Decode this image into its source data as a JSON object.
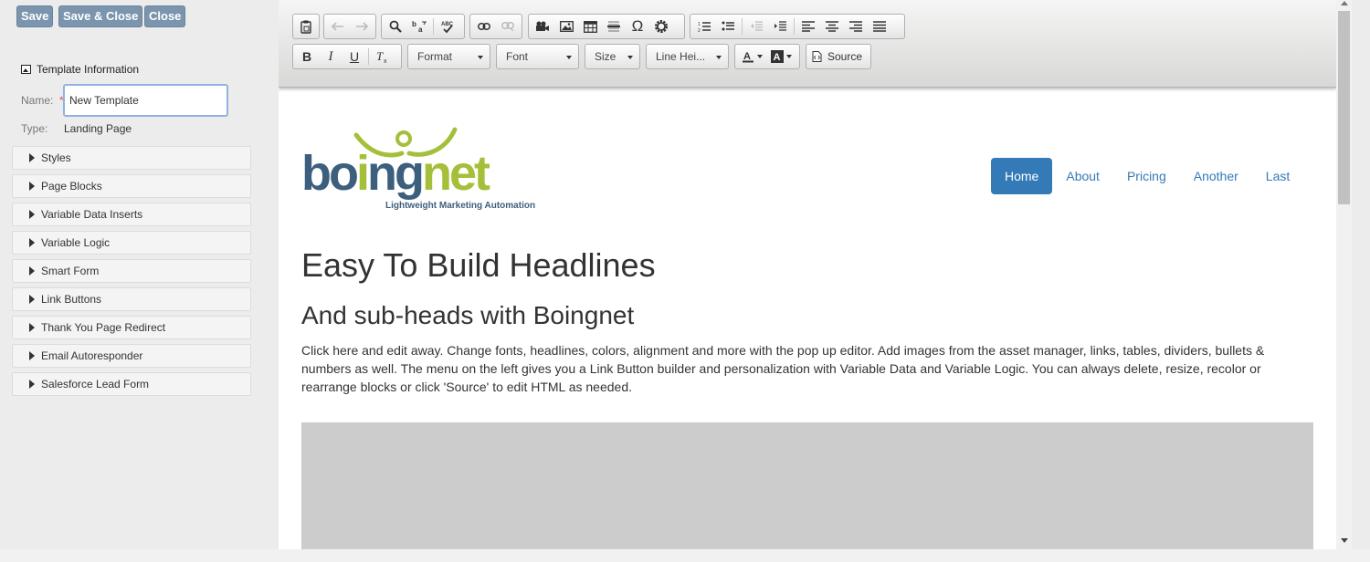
{
  "actions": {
    "save": "Save",
    "save_close": "Save & Close",
    "close": "Close"
  },
  "template_info": {
    "title": "Template Information",
    "name_label": "Name:",
    "required_mark": "*",
    "name_value": "New Template",
    "type_label": "Type:",
    "type_value": "Landing Page"
  },
  "sections": [
    "Styles",
    "Page Blocks",
    "Variable Data Inserts",
    "Variable Logic",
    "Smart Form",
    "Link Buttons",
    "Thank You Page Redirect",
    "Email Autoresponder",
    "Salesforce Lead Form"
  ],
  "toolbar": {
    "format": "Format",
    "font": "Font",
    "size": "Size",
    "line_height": "Line Hei...",
    "source": "Source",
    "bold": "B",
    "italic": "I",
    "underline": "U",
    "remove_format": "T",
    "special_char": "Ω"
  },
  "content": {
    "logo_text": "boingnet",
    "logo_tagline": "Lightweight Marketing Automation",
    "nav": [
      "Home",
      "About",
      "Pricing",
      "Another",
      "Last"
    ],
    "nav_active": "Home",
    "headline": "Easy To Build Headlines",
    "subhead": "And sub-heads with Boingnet",
    "body": "Click here and edit away. Change fonts, headlines, colors, alignment and more with the pop up editor. Add images from the asset manager, links, tables, dividers, bullets & numbers as well. The menu on the left gives you a Link Button builder and personalization with Variable Data and Variable Logic. You can always delete, resize, recolor or rearrange blocks or click 'Source' to edit HTML as needed."
  },
  "colors": {
    "button": "#7b95ae",
    "nav_active": "#337ab7",
    "link": "#337ab7",
    "logo_blue": "#3d5f7e",
    "logo_green": "#a4c03a"
  }
}
